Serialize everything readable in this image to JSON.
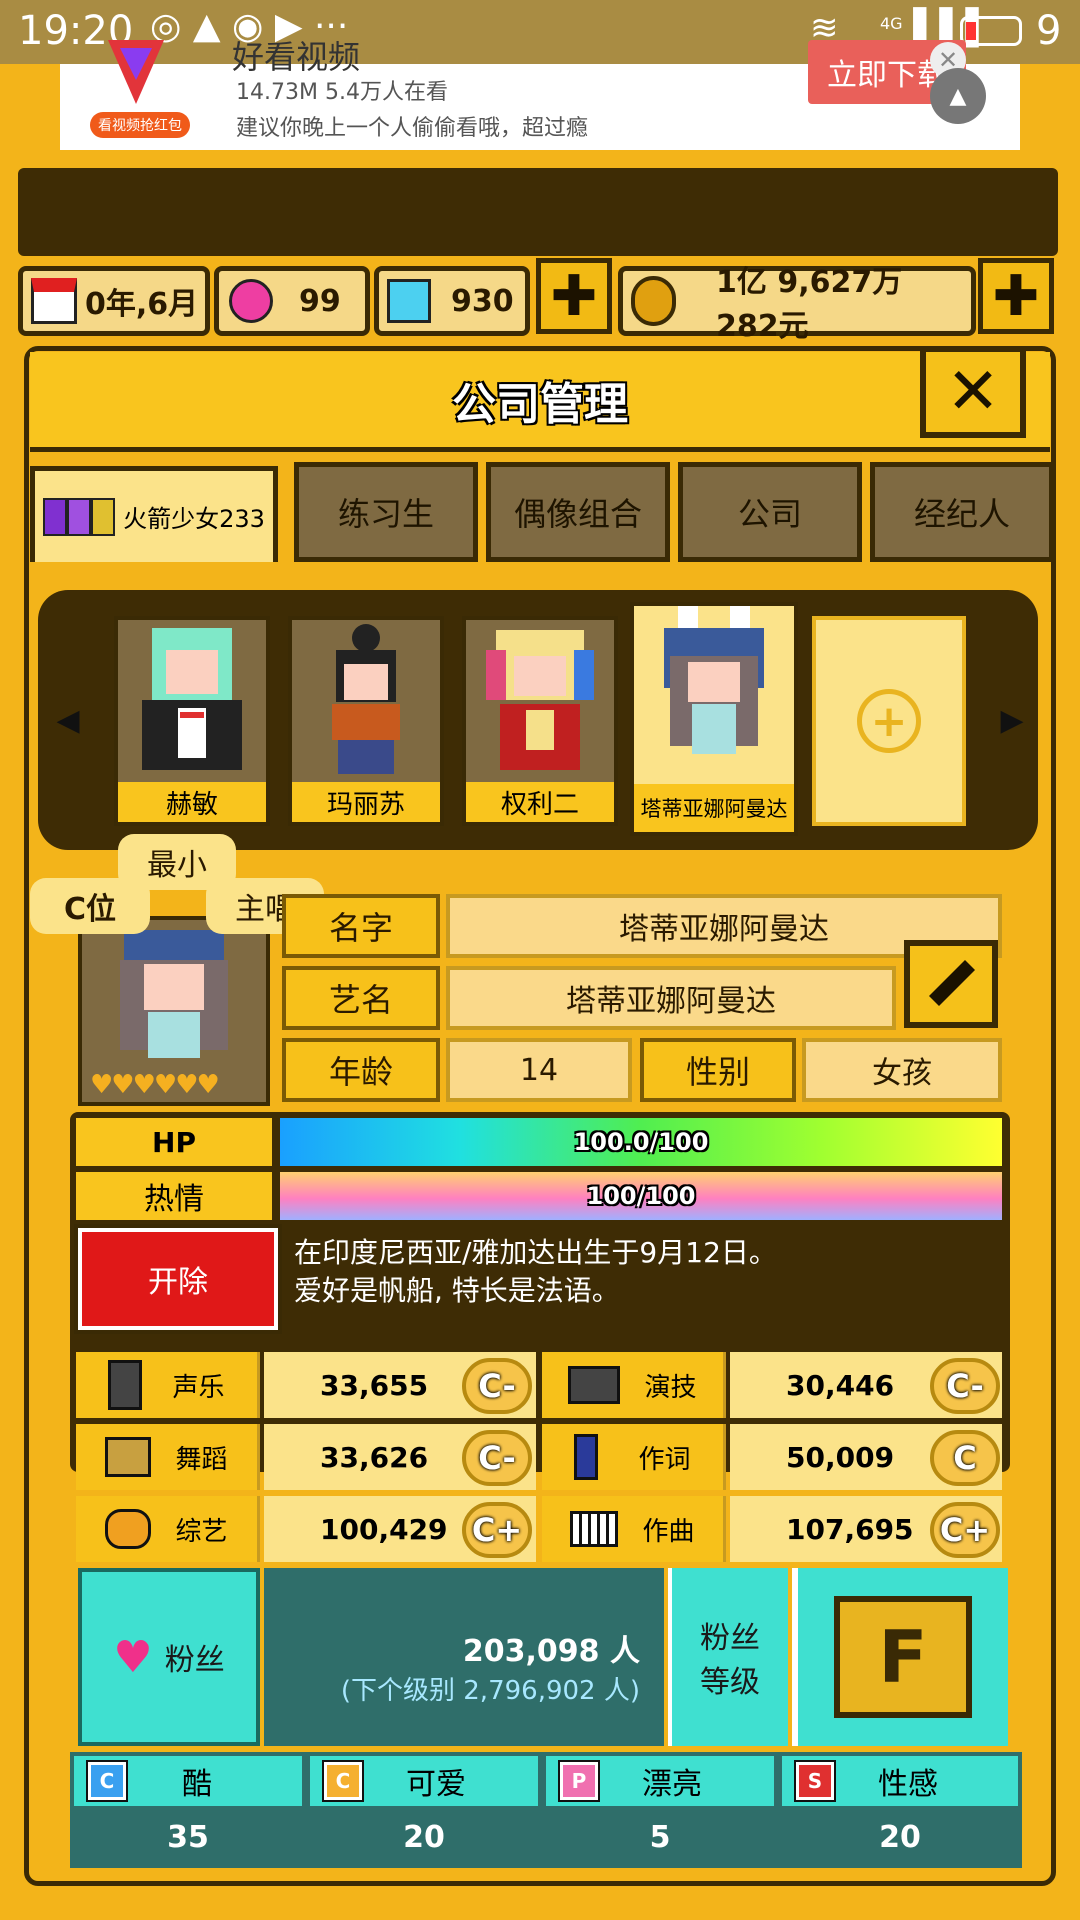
{
  "status_bar": {
    "time": "19:20",
    "network": "4G",
    "battery": "9"
  },
  "ad": {
    "title": "好看视频",
    "meta": "14.73M 5.4万人在看",
    "desc": "建议你晚上一个人偷偷看哦，超过瘾",
    "logo_caption": "看视频抢红包",
    "cta": "立即下载"
  },
  "resources": {
    "date": "0年,6月",
    "pink_gems": "99",
    "diamonds": "930",
    "money": "1亿 9,627万 282元"
  },
  "panel": {
    "title": "公司管理"
  },
  "tabs": [
    {
      "label": "火箭少女233"
    },
    {
      "label": "练习生"
    },
    {
      "label": "偶像组合"
    },
    {
      "label": "公司"
    },
    {
      "label": "经纪人"
    }
  ],
  "members": [
    {
      "name": "赫敏"
    },
    {
      "name": "玛丽苏"
    },
    {
      "name": "权利二"
    },
    {
      "name": "塔蒂亚娜阿曼达"
    }
  ],
  "profile": {
    "badges": {
      "left": "C位",
      "top": "最小",
      "right": "主唱"
    },
    "name_label": "名字",
    "name": "塔蒂亚娜阿曼达",
    "stage_label": "艺名",
    "stage_name": "塔蒂亚娜阿曼达",
    "age_label": "年龄",
    "age": "14",
    "gender_label": "性别",
    "gender": "女孩"
  },
  "bars": {
    "hp_label": "HP",
    "hp_text": "100.0/100",
    "hp_fraction": 1.0,
    "passion_label": "热情",
    "passion_text": "100/100",
    "passion_fraction": 1.0
  },
  "dismiss_label": "开除",
  "bio": {
    "line1": "在印度尼西亚/雅加达出生于9月12日。",
    "line2": "爱好是帆船, 特长是法语。"
  },
  "stats": [
    {
      "icon": "microphone-icon",
      "label": "声乐",
      "value": "33,655",
      "grade": "C-"
    },
    {
      "icon": "camera-icon",
      "label": "演技",
      "value": "30,446",
      "grade": "C-"
    },
    {
      "icon": "boot-icon",
      "label": "舞蹈",
      "value": "33,626",
      "grade": "C-"
    },
    {
      "icon": "pen-icon",
      "label": "作词",
      "value": "50,009",
      "grade": "C"
    },
    {
      "icon": "mask-icon",
      "label": "综艺",
      "value": "100,429",
      "grade": "C+"
    },
    {
      "icon": "piano-icon",
      "label": "作曲",
      "value": "107,695",
      "grade": "C+"
    }
  ],
  "fans": {
    "label": "粉丝",
    "count": "203,098 人",
    "next": "(下个级别 2,796,902 人)",
    "level_label_1": "粉丝",
    "level_label_2": "等级",
    "level": "F"
  },
  "attributes": [
    {
      "letter": "C",
      "label": "酷",
      "value": "35",
      "color": "#3aa0f0"
    },
    {
      "letter": "C",
      "label": "可爱",
      "value": "20",
      "color": "#f5b030"
    },
    {
      "letter": "P",
      "label": "漂亮",
      "value": "5",
      "color": "#f070b0"
    },
    {
      "letter": "S",
      "label": "性感",
      "value": "20",
      "color": "#e03030"
    }
  ]
}
